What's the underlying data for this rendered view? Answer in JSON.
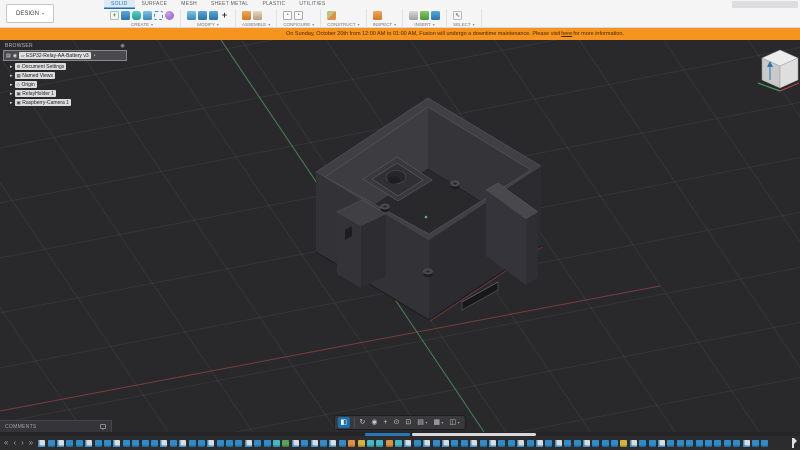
{
  "app": {
    "workspace": "DESIGN"
  },
  "colors": {
    "accent_blue": "#1A6FB5",
    "banner_orange": "#F5941E",
    "viewport_bg": "#29292B",
    "axis_x_red": "#8A4044",
    "axis_y_green": "#4D925C",
    "timeline_feature_blue": "#2F8CCB"
  },
  "ribbon": {
    "tabs": [
      {
        "label": "SOLID",
        "name": "tab-solid",
        "cls": "active"
      },
      {
        "label": "SURFACE",
        "name": "tab-surface",
        "cls": ""
      },
      {
        "label": "MESH",
        "name": "tab-mesh",
        "cls": ""
      },
      {
        "label": "SHEET METAL",
        "name": "tab-sheet-metal",
        "cls": ""
      },
      {
        "label": "PLASTIC",
        "name": "tab-plastic",
        "cls": ""
      },
      {
        "label": "UTILITIES",
        "name": "tab-utilities",
        "cls": ""
      }
    ],
    "groups": {
      "create": {
        "label": "CREATE"
      },
      "modify": {
        "label": "MODIFY"
      },
      "assemble": {
        "label": "ASSEMBLE"
      },
      "configure": {
        "label": "CONFIGURE"
      },
      "construct": {
        "label": "CONSTRUCT"
      },
      "inspect": {
        "label": "INSPECT"
      },
      "insert": {
        "label": "INSERT"
      },
      "select": {
        "label": "SELECT"
      }
    },
    "icons": {
      "create": [
        {
          "name": "create-sketch-icon",
          "cls": "ic-sketch",
          "glyph": "+"
        },
        {
          "name": "extrude-icon",
          "cls": "ic-blue",
          "glyph": ""
        },
        {
          "name": "form-icon",
          "cls": "ic-teal",
          "glyph": ""
        },
        {
          "name": "revolve-icon",
          "cls": "ic-blue2",
          "glyph": ""
        },
        {
          "name": "pattern-icon",
          "cls": "ic-dash",
          "glyph": ""
        },
        {
          "name": "sphere-icon",
          "cls": "ic-purple",
          "glyph": ""
        }
      ],
      "modify": [
        {
          "name": "press-pull-icon",
          "cls": "ic-blue2",
          "glyph": ""
        },
        {
          "name": "fillet-icon",
          "cls": "ic-blue",
          "glyph": ""
        },
        {
          "name": "shell-icon",
          "cls": "ic-blue",
          "glyph": ""
        },
        {
          "name": "move-copy-icon",
          "cls": "ic-cross",
          "glyph": "+"
        }
      ],
      "assemble": [
        {
          "name": "new-component-icon",
          "cls": "ic-orange",
          "glyph": ""
        },
        {
          "name": "joint-icon",
          "cls": "ic-beige",
          "glyph": ""
        }
      ],
      "configure": [
        {
          "name": "configuration-icon",
          "cls": "ic-sheet",
          "glyph": "•"
        },
        {
          "name": "configuration-table-icon",
          "cls": "ic-sheet",
          "glyph": "•"
        }
      ],
      "construct": [
        {
          "name": "construction-plane-icon",
          "cls": "ic-olive",
          "glyph": ""
        }
      ],
      "inspect": [
        {
          "name": "measure-icon",
          "cls": "ic-orange",
          "glyph": ""
        }
      ],
      "insert": [
        {
          "name": "derive-icon",
          "cls": "ic-gray",
          "glyph": ""
        },
        {
          "name": "insert-mesh-icon",
          "cls": "ic-green",
          "glyph": ""
        },
        {
          "name": "canvas-icon",
          "cls": "ic-blue",
          "glyph": ""
        }
      ],
      "select": [
        {
          "name": "select-cursor-icon",
          "cls": "ic-cursor",
          "glyph": "⇖"
        }
      ]
    }
  },
  "banner": {
    "text_before": "On Sunday, October 20th from 12:00 AM to 01:00 AM, Fusion will undergo a downtime maintenance. Please visit",
    "link_text": "here",
    "text_after": "for more information."
  },
  "browser": {
    "title": "BROWSER",
    "root": "ESP32-Relay-AA-Battery v3",
    "items": [
      {
        "label": "Document Settings",
        "icon": "gear-icon",
        "glyph": "⚙"
      },
      {
        "label": "Named Views",
        "icon": "named-views-icon",
        "glyph": "▦"
      },
      {
        "label": "Origin",
        "icon": "origin-icon",
        "glyph": "◇"
      },
      {
        "label": "RelayHolder 1",
        "icon": "component-icon",
        "glyph": "▣"
      },
      {
        "label": "Raspberry-Camera 1",
        "icon": "component-icon",
        "glyph": "▣"
      }
    ]
  },
  "navbar": {
    "items": [
      {
        "name": "component-color-swatch-icon",
        "glyph": "◧",
        "cls": "active"
      },
      {
        "name": "orbit-icon",
        "glyph": "↻",
        "cls": "sep"
      },
      {
        "name": "look-at-icon",
        "glyph": "◉",
        "cls": ""
      },
      {
        "name": "pan-icon",
        "glyph": "+",
        "cls": ""
      },
      {
        "name": "zoom-icon",
        "glyph": "⊙",
        "cls": ""
      },
      {
        "name": "fit-icon",
        "glyph": "⊡",
        "cls": ""
      },
      {
        "name": "display-settings-icon",
        "glyph": "▤",
        "cls": "",
        "caret": true
      },
      {
        "name": "grid-snaps-icon",
        "glyph": "▦",
        "cls": "",
        "caret": true
      },
      {
        "name": "viewports-icon",
        "glyph": "◫",
        "cls": "",
        "caret": true
      }
    ]
  },
  "comments": {
    "label": "COMMENTS"
  },
  "timeline": {
    "controls": [
      {
        "name": "timeline-go-to-start",
        "glyph": "«"
      },
      {
        "name": "timeline-step-back",
        "glyph": "‹"
      },
      {
        "name": "timeline-play",
        "glyph": "›"
      },
      {
        "name": "timeline-go-to-end",
        "glyph": "»"
      }
    ],
    "features": [
      "sketch",
      "blue",
      "sketch",
      "blue",
      "blue",
      "sketch",
      "blue",
      "blue",
      "sketch",
      "blue",
      "blue",
      "blue",
      "blue",
      "sketch",
      "blue",
      "sketch",
      "blue",
      "blue",
      "sketch",
      "blue",
      "blue",
      "blue",
      "sketch",
      "blue",
      "blue",
      "teal",
      "green",
      "sketch",
      "blue",
      "sketch",
      "blue",
      "sketch",
      "blue",
      "orange",
      "yellow",
      "teal",
      "teal",
      "orange",
      "teal",
      "sketch",
      "blue",
      "sketch",
      "blue",
      "sketch",
      "blue",
      "blue",
      "sketch",
      "blue",
      "sketch",
      "blue",
      "blue",
      "sketch",
      "blue",
      "sketch",
      "blue",
      "sketch",
      "blue",
      "blue",
      "sketch",
      "blue",
      "blue",
      "blue",
      "yellow",
      "sketch",
      "blue",
      "blue",
      "sketch",
      "blue",
      "blue",
      "blue",
      "blue",
      "blue",
      "blue",
      "blue",
      "blue",
      "sketch",
      "blue",
      "blue"
    ]
  }
}
